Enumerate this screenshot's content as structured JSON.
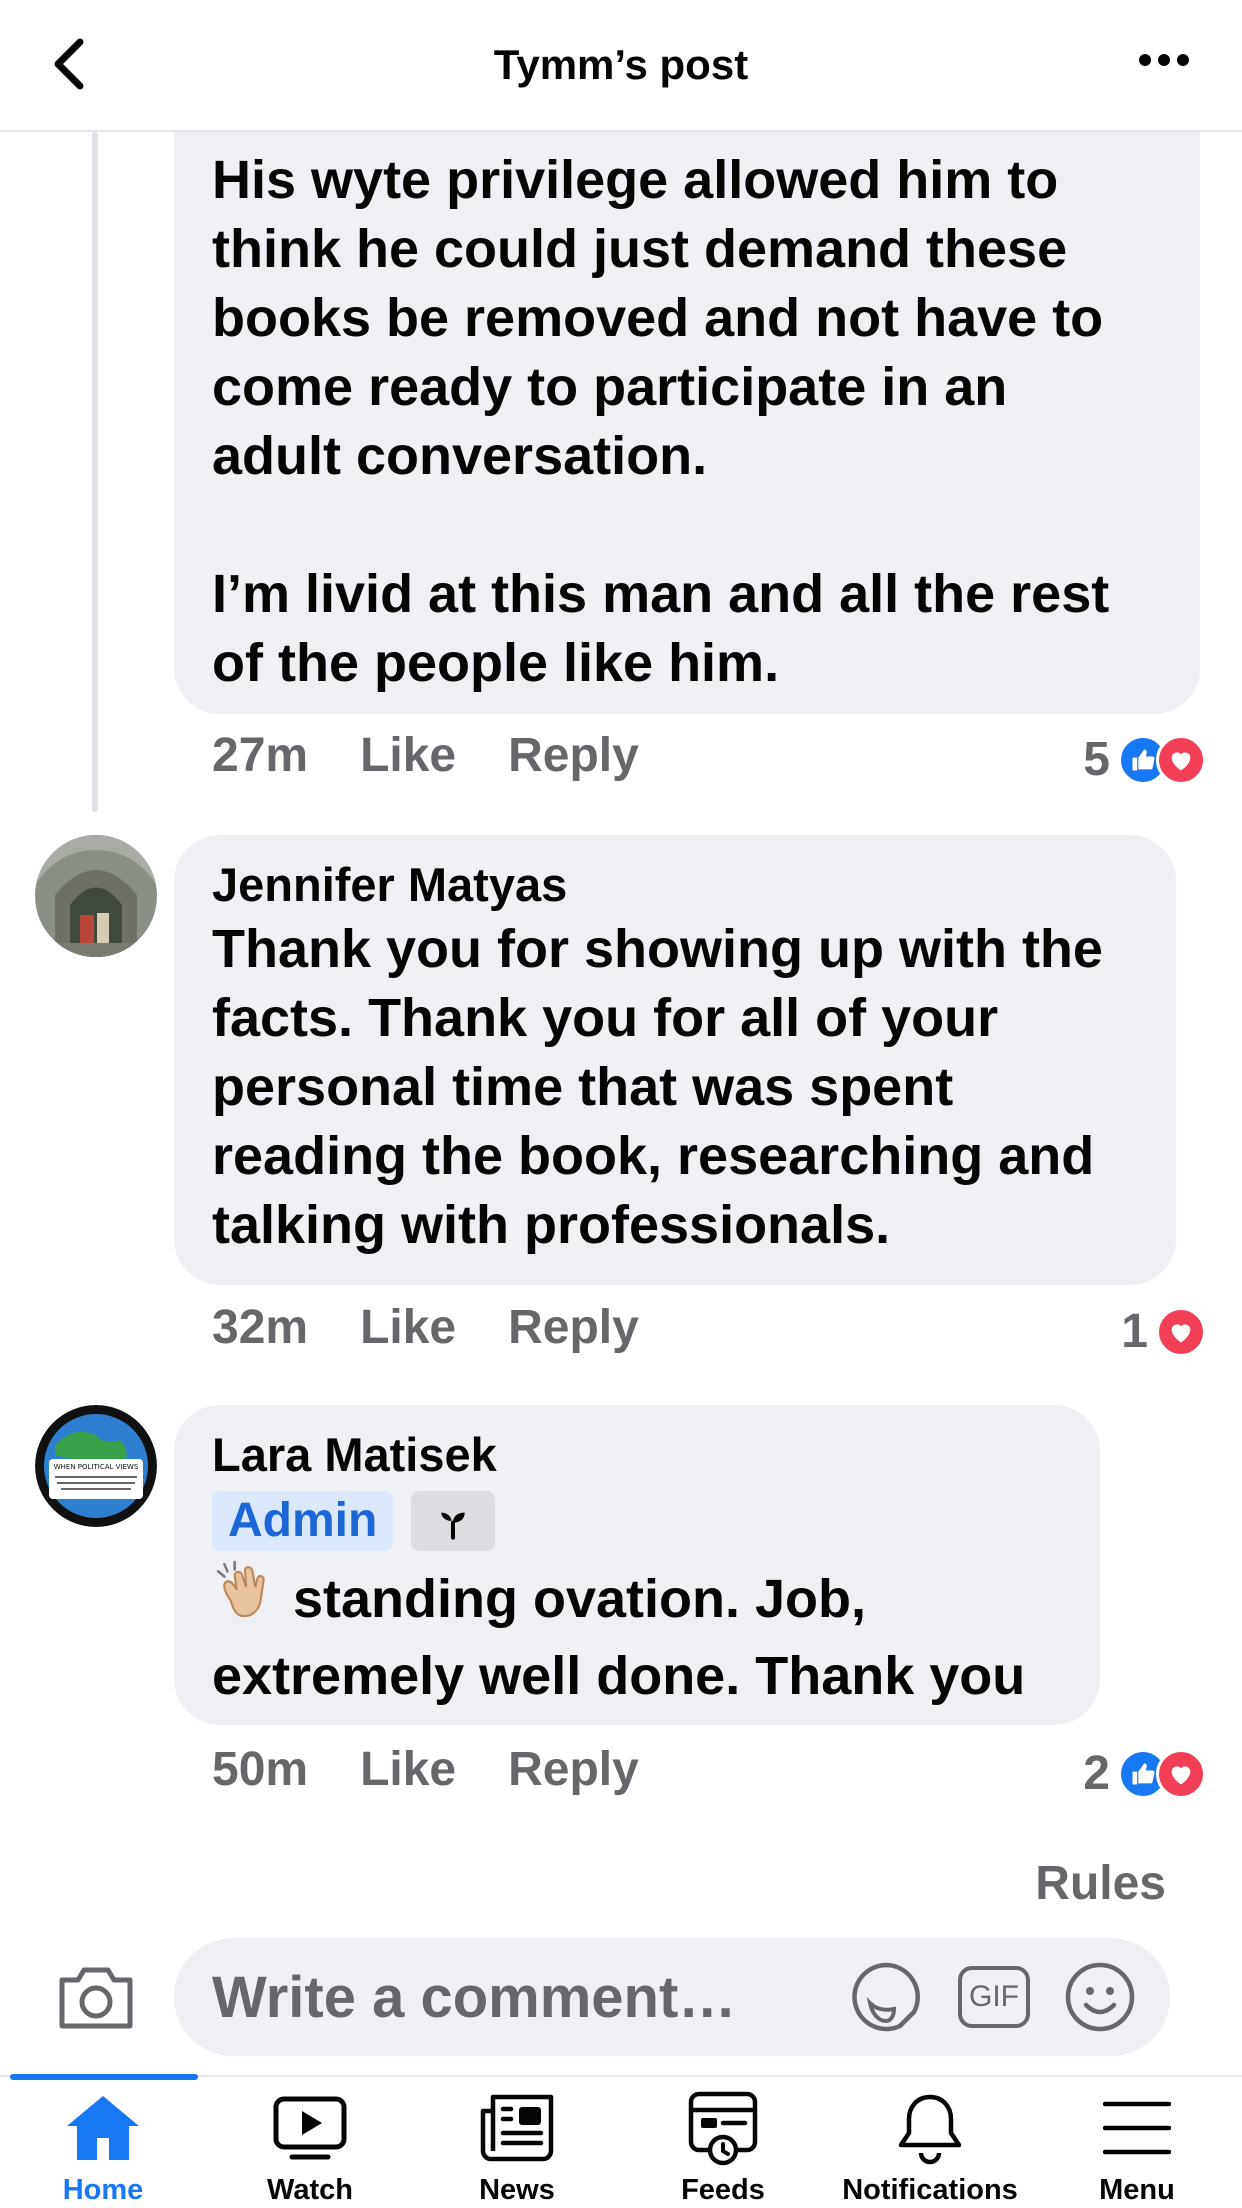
{
  "header": {
    "title": "Tymm’s post",
    "back_icon": "chevron-left-icon",
    "more_icon": "more-horizontal-icon"
  },
  "comments": [
    {
      "author": "",
      "text": "His wyte privilege allowed him to\nthink he could just demand these\nbooks be removed and not have to\ncome ready to participate in an\nadult conversation.\n\nI’m livid at this man and all the rest\nof the people like him.",
      "time": "27m",
      "like_label": "Like",
      "reply_label": "Reply",
      "reaction_count": "5",
      "reactions": [
        "like",
        "love"
      ]
    },
    {
      "author": "Jennifer Matyas",
      "text": "Thank you for showing up with the\nfacts. Thank you for all of your\npersonal time that was spent\nreading the book, researching and\ntalking with professionals.",
      "time": "32m",
      "like_label": "Like",
      "reply_label": "Reply",
      "reaction_count": "1",
      "reactions": [
        "love"
      ]
    },
    {
      "author": "Lara Matisek",
      "badge": "Admin",
      "text": " standing ovation. Job,\nextremely well done. Thank you",
      "emoji_icon": "clapping-hands-icon",
      "time": "50m",
      "like_label": "Like",
      "reply_label": "Reply",
      "reaction_count": "2",
      "reactions": [
        "like",
        "love"
      ],
      "avatar_text": "WHEN POLITICAL VIEWS"
    }
  ],
  "composer": {
    "rules_label": "Rules",
    "placeholder": "Write a comment…",
    "gif_label": "GIF"
  },
  "nav": {
    "items": [
      {
        "label": "Home",
        "icon": "home-icon",
        "active": true
      },
      {
        "label": "Watch",
        "icon": "watch-icon",
        "active": false
      },
      {
        "label": "News",
        "icon": "news-icon",
        "active": false
      },
      {
        "label": "Feeds",
        "icon": "feeds-icon",
        "active": false
      },
      {
        "label": "Notifications",
        "icon": "bell-icon",
        "active": false
      },
      {
        "label": "Menu",
        "icon": "menu-icon",
        "active": false
      }
    ]
  },
  "colors": {
    "accent": "#1877f2",
    "love": "#f33e58",
    "bubble": "#eff0f3",
    "meta_text": "#65676b",
    "admin_badge_bg": "#dbe7fb",
    "admin_badge_text": "#1b67d8"
  }
}
